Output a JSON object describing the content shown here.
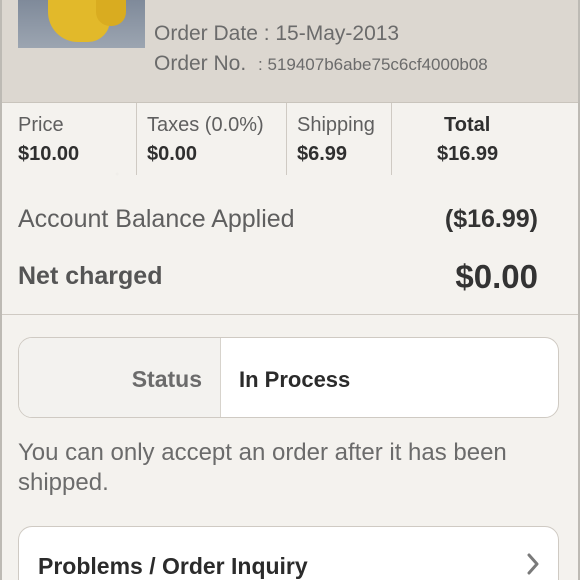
{
  "header": {
    "order_date_label": "Order Date : 15-May-2013",
    "order_no_label": "Order No.",
    "order_no_value": ": 519407b6abe75c6cf4000b08"
  },
  "price_table": {
    "price": {
      "label": "Price",
      "value": "$10.00"
    },
    "taxes": {
      "label": "Taxes (0.0%)",
      "value": "$0.00"
    },
    "shipping": {
      "label": "Shipping",
      "value": "$6.99"
    },
    "total": {
      "label": "Total",
      "value": "$16.99"
    }
  },
  "balance": {
    "applied_label": "Account Balance Applied",
    "applied_value": "($16.99)",
    "net_label": "Net charged",
    "net_value": "$0.00"
  },
  "status": {
    "label": "Status",
    "value": "In Process"
  },
  "notice": "You can only accept an order after it has been shipped.",
  "problems": {
    "label": "Problems / Order Inquiry",
    "icon": "chevron-right-icon"
  },
  "colors": {
    "background": "#f4f2ee",
    "header": "#dcd7d0",
    "text_dark": "#2f2f2f",
    "text_muted": "#6b6b6b"
  }
}
